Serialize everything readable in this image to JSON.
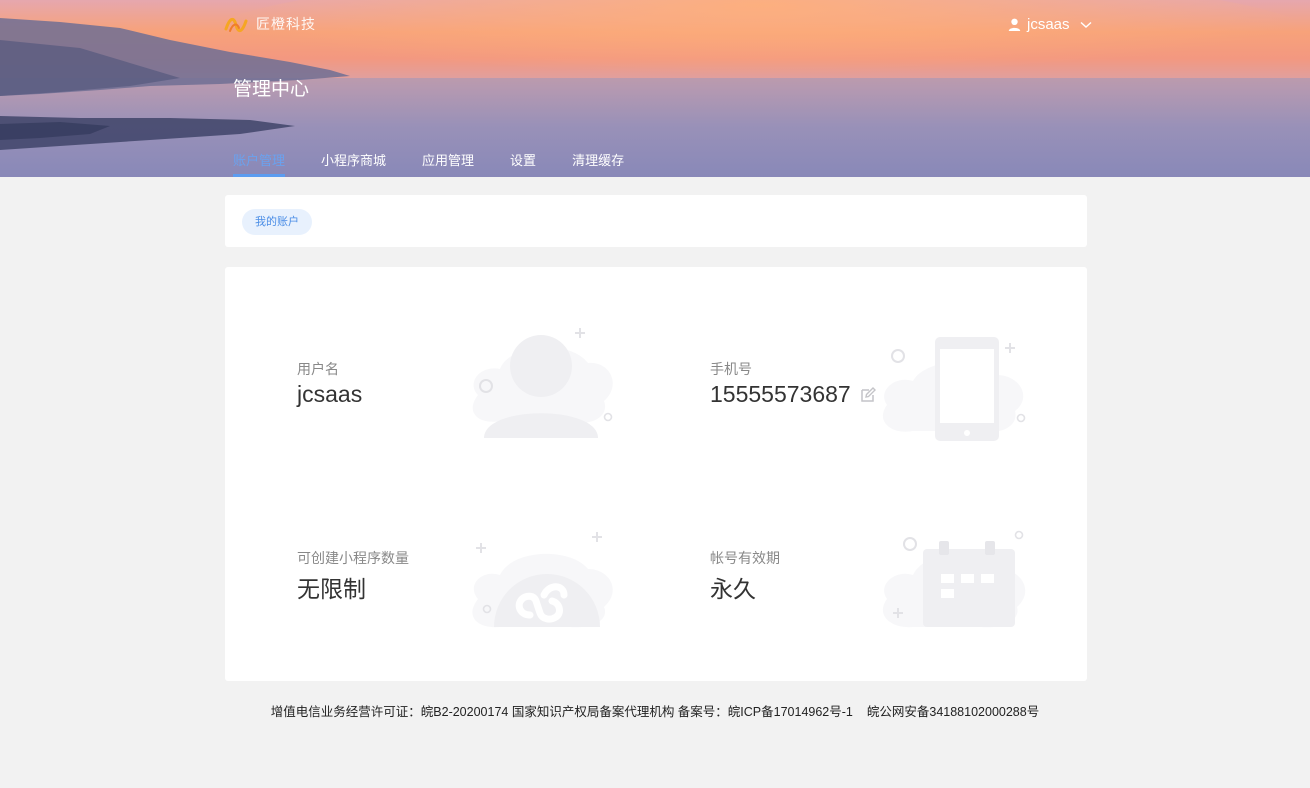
{
  "header": {
    "logo_text": "匠橙科技",
    "username": "jcsaas",
    "page_title": "管理中心",
    "tabs": [
      {
        "label": "账户管理",
        "active": true
      },
      {
        "label": "小程序商城",
        "active": false
      },
      {
        "label": "应用管理",
        "active": false
      },
      {
        "label": "设置",
        "active": false
      },
      {
        "label": "清理缓存",
        "active": false
      }
    ]
  },
  "breadcrumb": {
    "current": "我的账户"
  },
  "account": {
    "username": {
      "label": "用户名",
      "value": "jcsaas",
      "icon": "user-icon"
    },
    "phone": {
      "label": "手机号",
      "value": "15555573687",
      "icon": "phone-icon"
    },
    "miniprogram_quota": {
      "label": "可创建小程序数量",
      "value": "无限制",
      "icon": "miniprogram-icon"
    },
    "expiry": {
      "label": "帐号有效期",
      "value": "永久",
      "icon": "calendar-icon"
    }
  },
  "footer": {
    "license": "增值电信业务经营许可证：皖B2-20200174 国家知识产权局备案代理机构 备案号：皖ICP备17014962号-1",
    "police": "皖公网安备34188102000288号"
  },
  "colors": {
    "accent": "#5b9cf0",
    "pill_bg": "#e8f1fd",
    "deco_gray": "#efeff2",
    "page_bg": "#f2f2f2"
  }
}
